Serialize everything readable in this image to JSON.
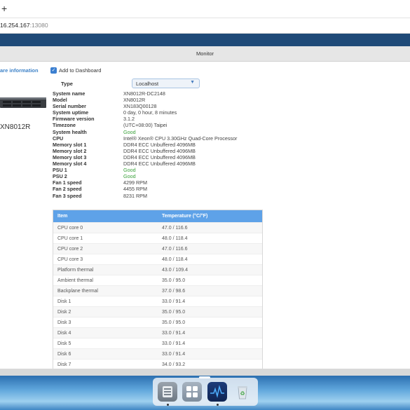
{
  "browser": {
    "new_tab_symbol": "+",
    "url_host": "16.254.167",
    "url_port": ":13080"
  },
  "header": {
    "title": "Monitor"
  },
  "sidebar": {
    "section_label": "are information"
  },
  "dashboard": {
    "checked": true,
    "label": "Add to Dashboard"
  },
  "device": {
    "name": "XN8012R"
  },
  "type": {
    "label": "Type",
    "selected": "Localhost"
  },
  "info": [
    {
      "key": "System name",
      "value": "XN8012R-DC2148",
      "status": "normal"
    },
    {
      "key": "Model",
      "value": "XN8012R",
      "status": "normal"
    },
    {
      "key": "Serial number",
      "value": "XN183Q00128",
      "status": "normal"
    },
    {
      "key": "System uptime",
      "value": "0 day, 0 hour, 8 minutes",
      "status": "normal"
    },
    {
      "key": "Firmware version",
      "value": "3.1.2",
      "status": "normal"
    },
    {
      "key": "Timezone",
      "value": "(UTC+08:00) Taipei",
      "status": "normal"
    },
    {
      "key": "System health",
      "value": "Good",
      "status": "good"
    },
    {
      "key": "CPU",
      "value": "Intel® Xeon® CPU 3.30GHz Quad-Core Processor",
      "status": "normal"
    },
    {
      "key": "Memory slot 1",
      "value": "DDR4 ECC Unbuffered 4096MB",
      "status": "normal"
    },
    {
      "key": "Memory slot 2",
      "value": "DDR4 ECC Unbuffered 4096MB",
      "status": "normal"
    },
    {
      "key": "Memory slot 3",
      "value": "DDR4 ECC Unbuffered 4096MB",
      "status": "normal"
    },
    {
      "key": "Memory slot 4",
      "value": "DDR4 ECC Unbuffered 4096MB",
      "status": "normal"
    },
    {
      "key": "PSU 1",
      "value": "Good",
      "status": "good"
    },
    {
      "key": "PSU 2",
      "value": "Good",
      "status": "good"
    },
    {
      "key": "Fan 1 speed",
      "value": "4299 RPM",
      "status": "normal"
    },
    {
      "key": "Fan 2 speed",
      "value": "4455 RPM",
      "status": "normal"
    },
    {
      "key": "Fan 3 speed",
      "value": "8231 RPM",
      "status": "normal"
    }
  ],
  "temperature_table": {
    "columns": [
      "Item",
      "Temperature (°C/°F)"
    ],
    "rows": [
      [
        "CPU core 0",
        "47.0 / 116.6"
      ],
      [
        "CPU core 1",
        "48.0 / 118.4"
      ],
      [
        "CPU core 2",
        "47.0 / 116.6"
      ],
      [
        "CPU core 3",
        "48.0 / 118.4"
      ],
      [
        "Platform thermal",
        "43.0 / 109.4"
      ],
      [
        "Ambient thermal",
        "35.0 / 95.0"
      ],
      [
        "Backplane thermal",
        "37.0 / 98.6"
      ],
      [
        "Disk 1",
        "33.0 / 91.4"
      ],
      [
        "Disk 2",
        "35.0 / 95.0"
      ],
      [
        "Disk 3",
        "35.0 / 95.0"
      ],
      [
        "Disk 4",
        "33.0 / 91.4"
      ],
      [
        "Disk 5",
        "33.0 / 91.4"
      ],
      [
        "Disk 6",
        "33.0 / 91.4"
      ],
      [
        "Disk 7",
        "34.0 / 93.2"
      ]
    ]
  },
  "dock": {
    "items": [
      "storage-manager-icon",
      "app-grid-icon",
      "resource-monitor-icon",
      "recycle-bin-icon"
    ]
  },
  "colors": {
    "app_bar": "#1f4a78",
    "link": "#3f83c8",
    "good": "#3aa23a",
    "table_header": "#5ea2e8"
  }
}
